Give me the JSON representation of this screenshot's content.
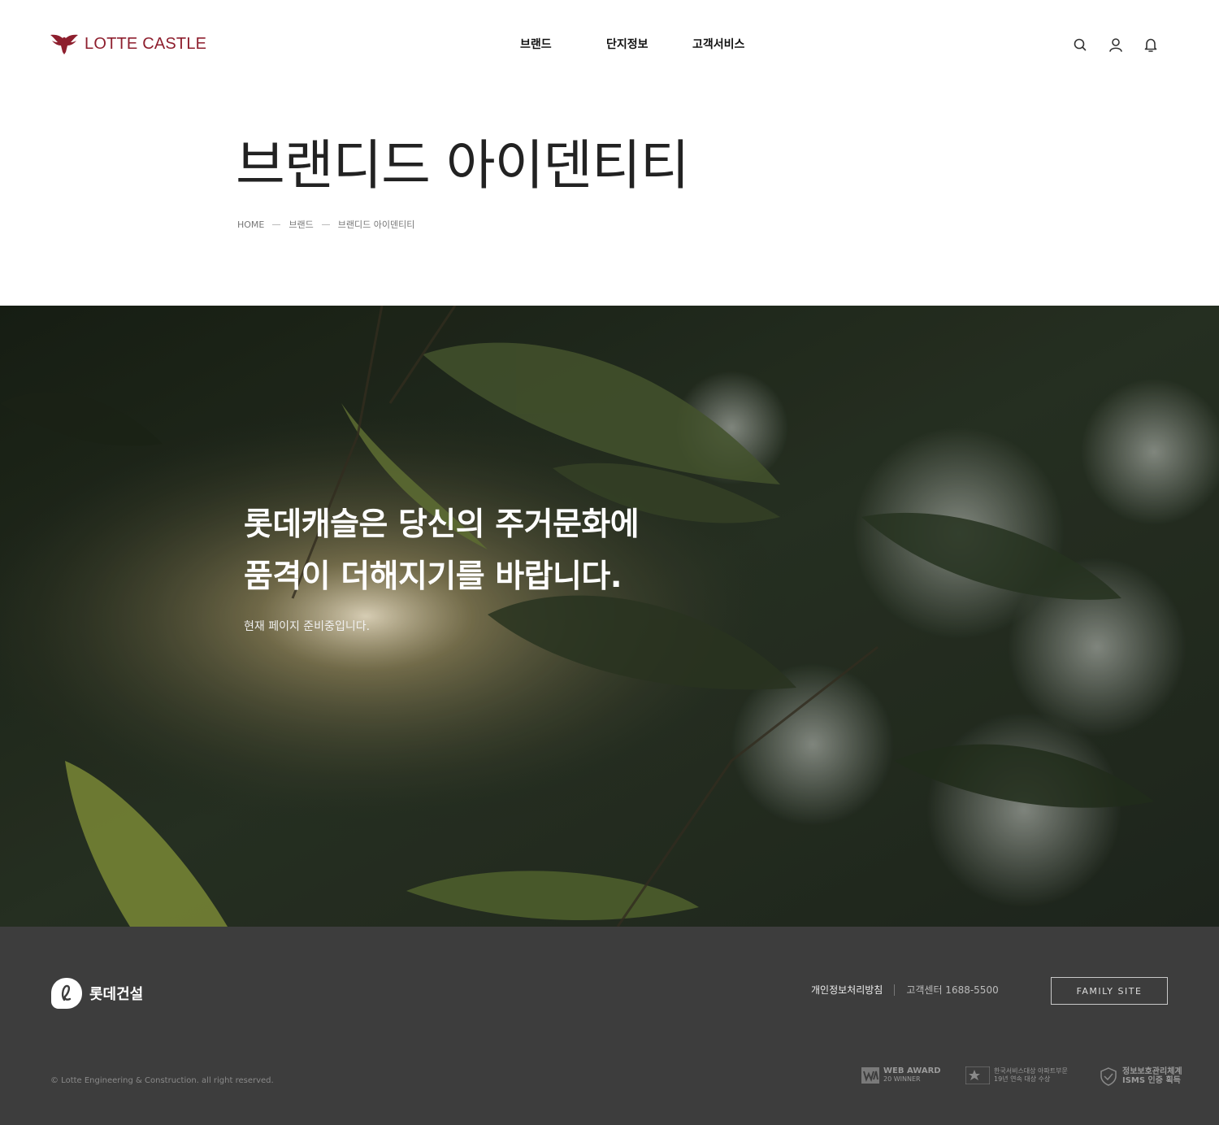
{
  "header": {
    "logo_text": "LOTTE CASTLE",
    "nav": [
      "브랜드",
      "단지정보",
      "고객서비스"
    ]
  },
  "page": {
    "title": "브랜디드 아이덴티티",
    "breadcrumb": [
      "HOME",
      "브랜드",
      "브랜디드 아이덴티티"
    ]
  },
  "hero": {
    "headline_line1": "롯데캐슬은 당신의 주거문화에",
    "headline_line2": "품격이 더해지기를 바랍니다.",
    "sub": "현재 페이지 준비중입니다."
  },
  "footer": {
    "logo_text": "롯데건설",
    "privacy": "개인정보처리방침",
    "cs_label": "고객센터 1688-5500",
    "family_site": "FAMILY SITE",
    "copyright": "© Lotte Engineering & Construction. all right reserved.",
    "awards": [
      {
        "line1": "WEB AWARD",
        "line2": "20 WINNER"
      },
      {
        "line1": "한국서비스대상 아파트부문",
        "line2": "19년 연속 대상 수상"
      },
      {
        "line1": "정보보호관리체계",
        "line2": "ISMS 인증 획득"
      }
    ]
  },
  "colors": {
    "brand": "#8e1f2e",
    "footer_bg": "#3d3d3d"
  },
  "icons": [
    "eagle-logo-icon",
    "search-icon",
    "user-icon",
    "bell-icon",
    "lotte-e-logo-icon"
  ]
}
